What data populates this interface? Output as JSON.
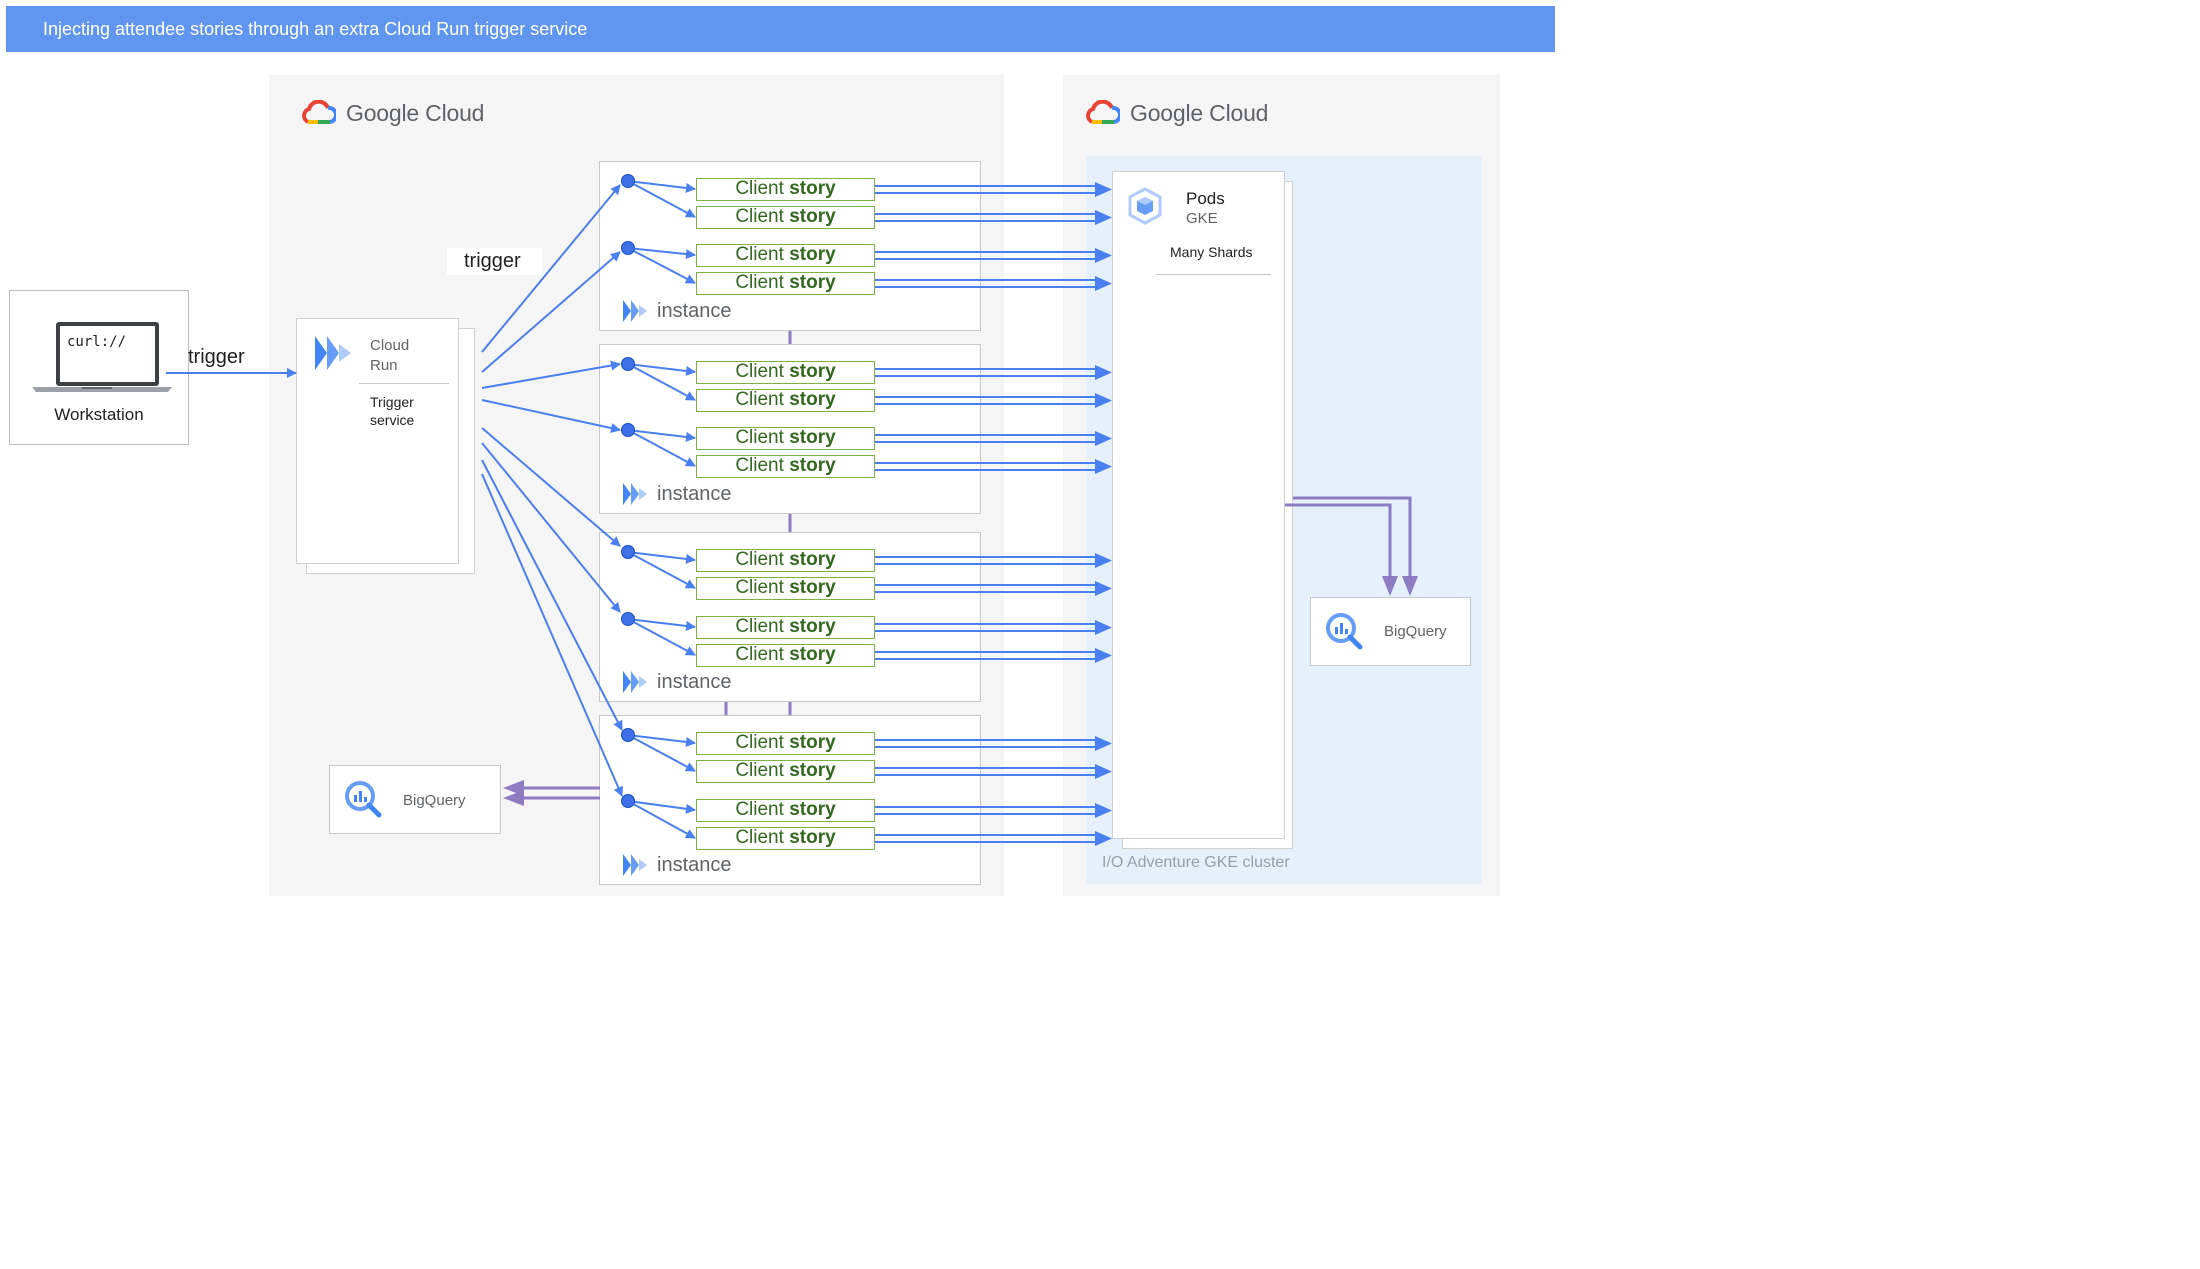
{
  "header": {
    "title": "Injecting attendee stories through an extra Cloud Run trigger service"
  },
  "google_cloud": {
    "brand": "Google Cloud"
  },
  "workstation": {
    "screen_text": "curl://",
    "label": "Workstation"
  },
  "trigger_labels": {
    "left": "trigger",
    "middle": "trigger"
  },
  "cloud_run": {
    "title": "Cloud\nRun",
    "subtitle": "Trigger\nservice"
  },
  "instance": {
    "label": "instance"
  },
  "story": {
    "prefix": "Client ",
    "bold": "story"
  },
  "pods": {
    "title": "Pods",
    "subtitle": "GKE",
    "desc": "Many Shards"
  },
  "cluster": {
    "label": "I/O Adventure GKE cluster"
  },
  "bigquery": {
    "label": "BigQuery"
  },
  "colors": {
    "arrow_blue": "#4a7ff0",
    "arrow_purple": "#8e7cc3",
    "story_border": "#7cb342",
    "story_text": "#33691e",
    "header_bg": "#6196f0"
  }
}
